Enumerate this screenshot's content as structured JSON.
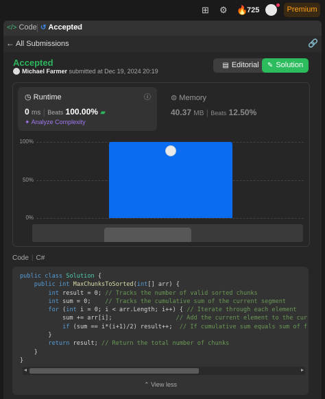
{
  "topbar": {
    "streak_count": "725",
    "premium_label": "Premium"
  },
  "tabs": {
    "code_label": "Code",
    "accepted_label": "Accepted",
    "close_glyph": "×"
  },
  "back": {
    "label": "All Submissions"
  },
  "submission": {
    "status": "Accepted",
    "user": "Michael Farmer",
    "submitted_text": "submitted at Dec 19, 2024 20:19"
  },
  "actions": {
    "editorial_label": "Editorial",
    "solution_label": "Solution"
  },
  "runtime": {
    "title": "Runtime",
    "value": "0",
    "unit": "ms",
    "beats_label": "Beats",
    "beats_pct": "100.00%",
    "analyze_label": "Analyze Complexity"
  },
  "memory": {
    "title": "Memory",
    "value": "40.37",
    "unit": "MB",
    "beats_label": "Beats",
    "beats_pct": "12.50%"
  },
  "chart_data": {
    "type": "bar",
    "ytick_labels": [
      "100%",
      "50%",
      "0%"
    ],
    "ylim": [
      0,
      100
    ],
    "values": [
      100
    ],
    "colors": {
      "bar": "#0a6cf0"
    }
  },
  "code": {
    "tab_label": "Code",
    "language": "C#",
    "view_less_label": "View less"
  },
  "colors": {
    "accent_green": "#2cbb5d",
    "accent_orange": "#ffa116",
    "bar_blue": "#0a6cf0"
  }
}
